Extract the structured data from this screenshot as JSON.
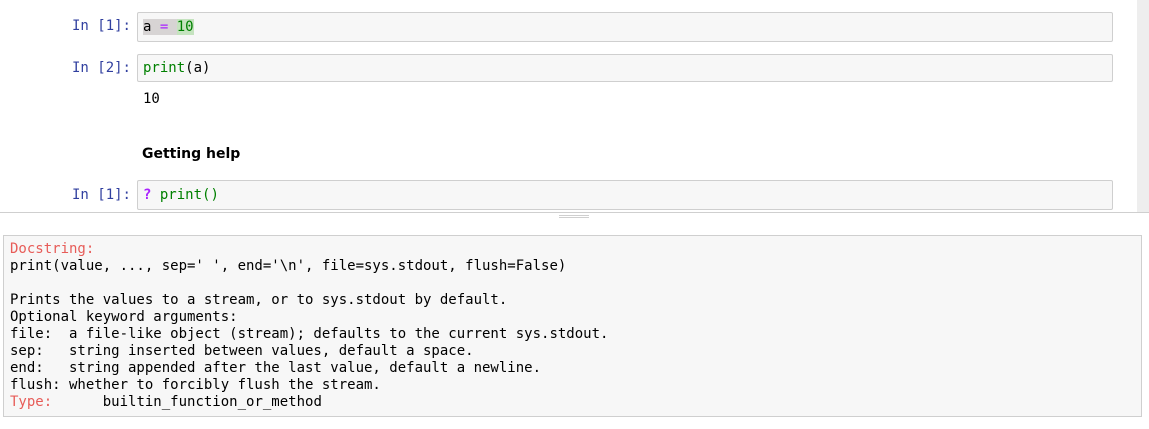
{
  "notebook": {
    "cells": [
      {
        "prompt": "In [1]:",
        "code": {
          "var": "a",
          "op": "=",
          "value": "10"
        }
      },
      {
        "prompt": "In [2]:",
        "code": {
          "func": "print",
          "open": "(",
          "arg": "a",
          "close": ")"
        },
        "output": "10"
      },
      {
        "markdown_heading": "Getting help"
      },
      {
        "prompt": "In [1]:",
        "code": {
          "op": "?",
          "func": "print()"
        }
      }
    ]
  },
  "pager": {
    "docstring_label": "Docstring:",
    "signature": "print(value, ..., sep=' ', end='\\n', file=sys.stdout, flush=False)",
    "blank": "",
    "lines": [
      "Prints the values to a stream, or to sys.stdout by default.",
      "Optional keyword arguments:",
      "file:  a file-like object (stream); defaults to the current sys.stdout.",
      "sep:   string inserted between values, default a space.",
      "end:   string appended after the last value, default a newline.",
      "flush: whether to forcibly flush the stream."
    ],
    "type_label": "Type:",
    "type_value": "builtin_function_or_method",
    "type_padding": "      "
  },
  "colors": {
    "prompt": "#303f9f",
    "keyword_green": "#008000",
    "operator_purple": "#aa22ff",
    "pager_label_red": "#e75c58"
  }
}
